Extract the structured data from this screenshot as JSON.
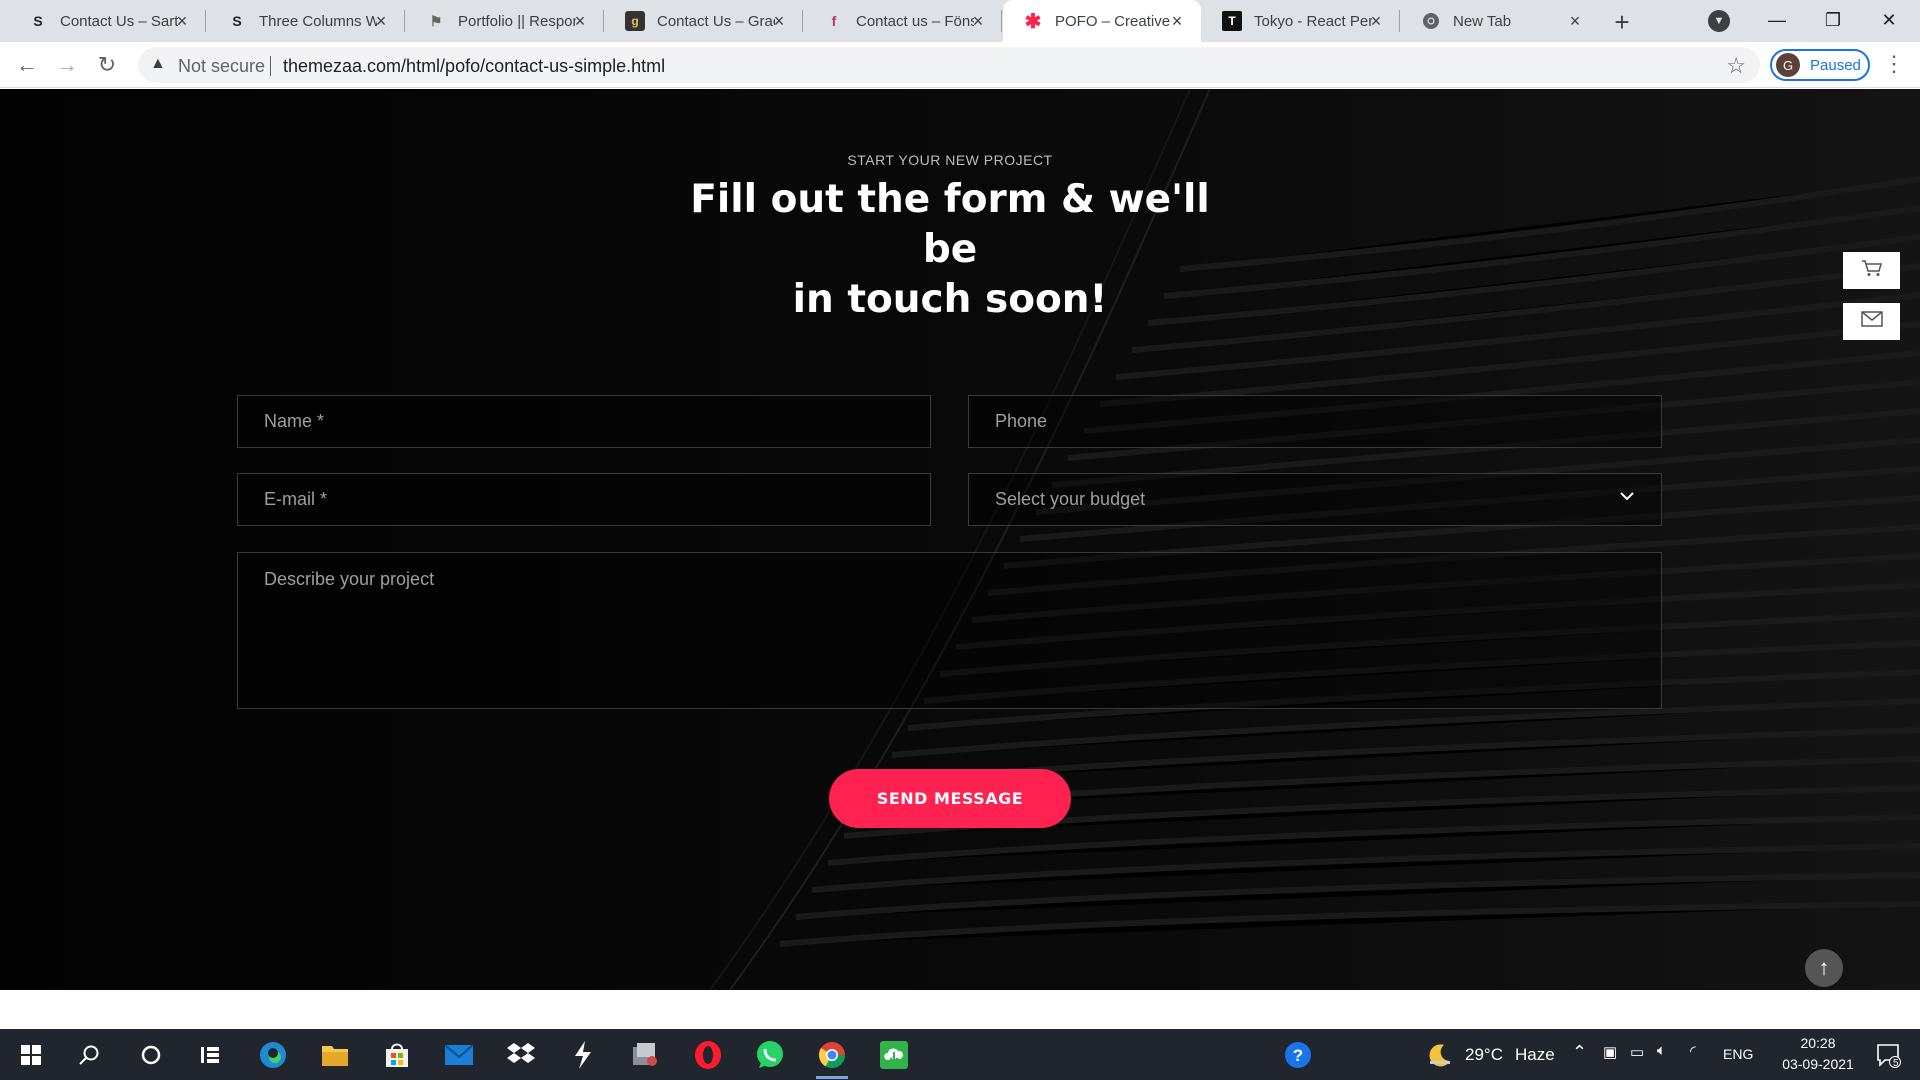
{
  "browser": {
    "tabs": [
      {
        "title": "Contact Us – Sartor",
        "favicon": "S"
      },
      {
        "title": "Three Columns With",
        "favicon": "S"
      },
      {
        "title": "Portfolio || Responsive",
        "favicon": "flag"
      },
      {
        "title": "Contact Us – Graciano",
        "favicon": "g"
      },
      {
        "title": "Contact us – Fönster",
        "favicon": "f"
      },
      {
        "title": "POFO – Creative Agency",
        "favicon": "asterisk",
        "active": true
      },
      {
        "title": "Tokyo - React Personal",
        "favicon": "T"
      },
      {
        "title": "New Tab",
        "favicon": "chrome"
      }
    ],
    "address": {
      "security_label": "Not secure",
      "url": "themezaa.com/html/pofo/contact-us-simple.html"
    },
    "profile": {
      "initial": "G",
      "status": "Paused"
    }
  },
  "page": {
    "eyebrow": "START YOUR NEW PROJECT",
    "headline_line1": "Fill out the form & we'll be",
    "headline_line2": "in touch soon!",
    "form": {
      "name_placeholder": "Name *",
      "phone_placeholder": "Phone",
      "email_placeholder": "E-mail *",
      "budget_placeholder": "Select your budget",
      "project_placeholder": "Describe your project",
      "submit_label": "SEND MESSAGE"
    },
    "accent_color": "#ff214f",
    "side_buttons": [
      "cart-icon",
      "envelope-icon"
    ]
  },
  "taskbar": {
    "weather_temp": "29°C",
    "weather_desc": "Haze",
    "language": "ENG",
    "time": "20:28",
    "date": "03-09-2021",
    "notifications_count": "5"
  }
}
